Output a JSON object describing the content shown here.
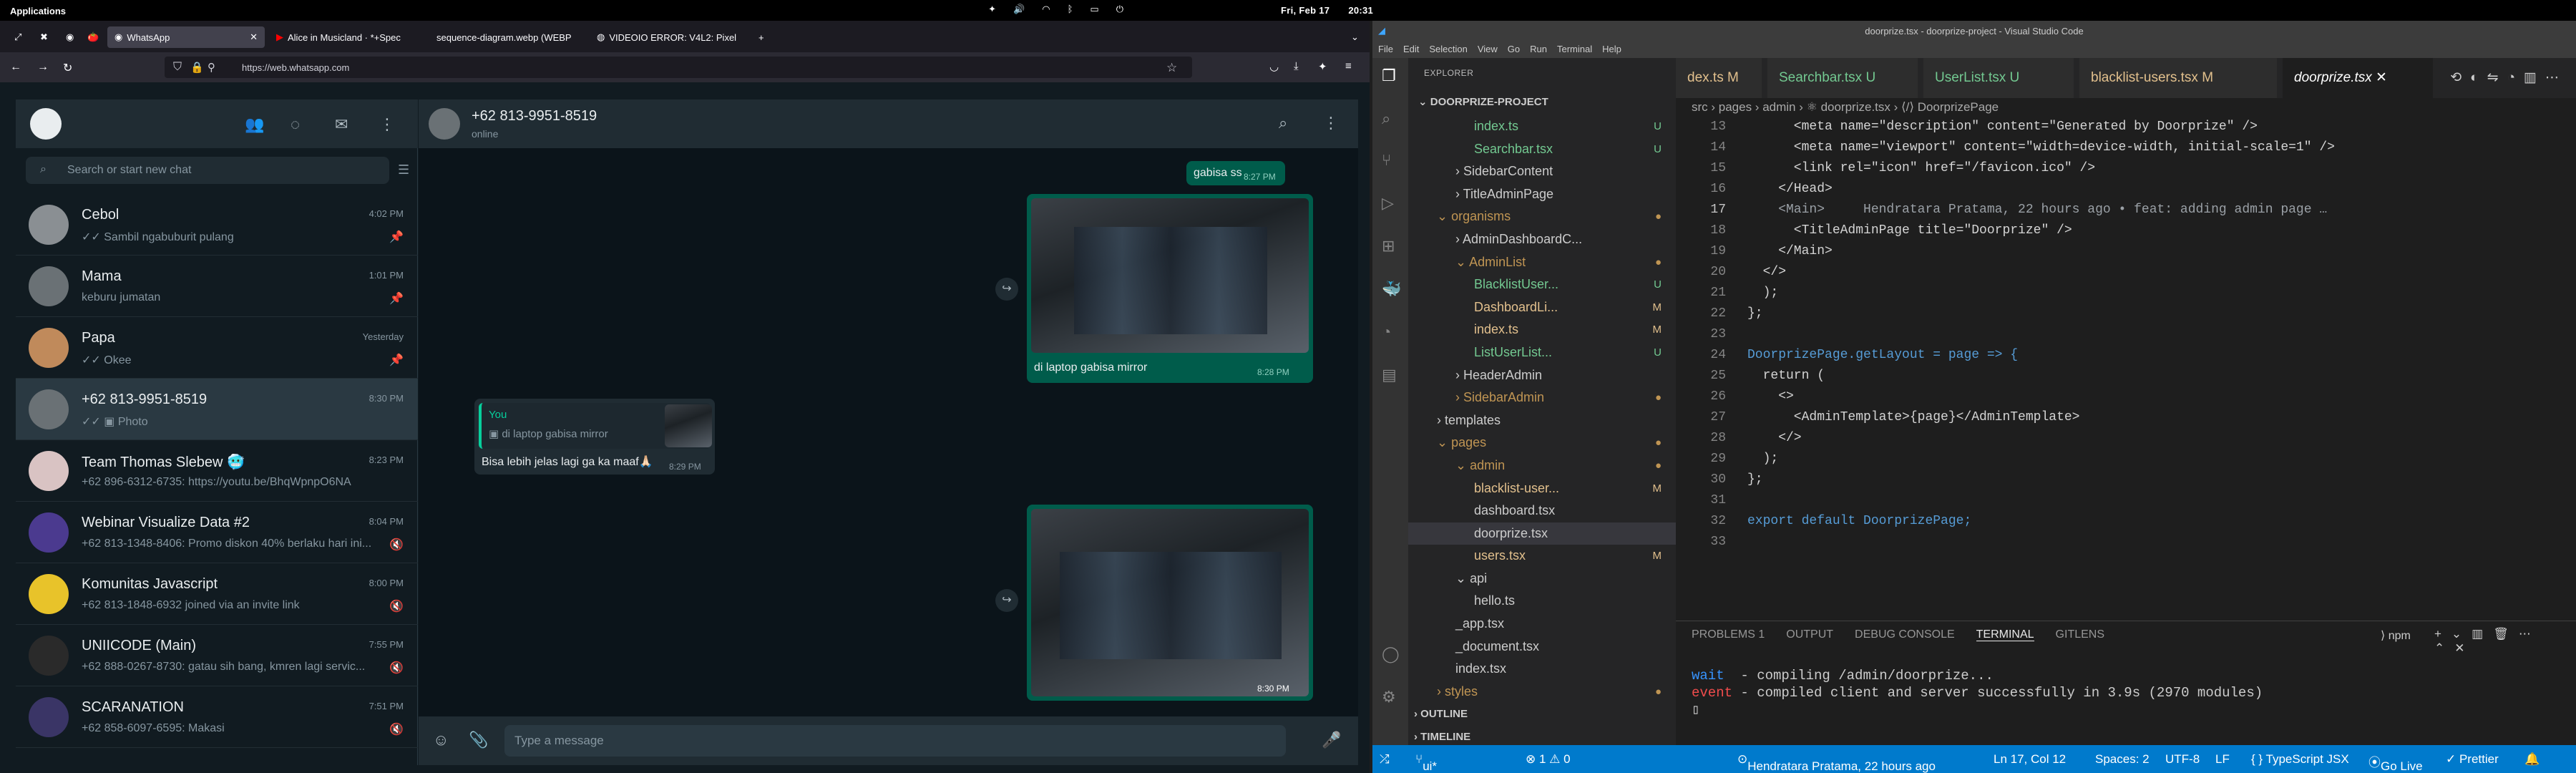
{
  "system": {
    "applications": "Applications",
    "date": "Fri, Feb 17",
    "time": "20:31"
  },
  "firefox": {
    "tabs": [
      "WhatsApp",
      "Alice in Musicland · *+Spec",
      "sequence-diagram.webp (WEBP",
      "VIDEOIO ERROR: V4L2: Pixel"
    ],
    "url": "https://web.whatsapp.com"
  },
  "whatsapp": {
    "search_placeholder": "Search or start new chat",
    "chats": [
      {
        "name": "Cebol",
        "time": "4:02 PM",
        "preview": "✓✓ Sambil ngabuburit pulang",
        "pinned": true
      },
      {
        "name": "Mama",
        "time": "1:01 PM",
        "preview": "keburu jumatan",
        "pinned": true
      },
      {
        "name": "Papa",
        "time": "Yesterday",
        "preview": "✓✓ Okee",
        "pinned": true
      },
      {
        "name": "+62 813-9951-8519",
        "time": "8:30 PM",
        "preview": "✓✓ ▣ Photo",
        "pinned": false
      },
      {
        "name": "Team Thomas Slebew 🥶",
        "time": "8:23 PM",
        "preview": "+62 896-6312-6735: https://youtu.be/BhqWpnpO6NA",
        "pinned": false
      },
      {
        "name": "Webinar Visualize Data #2",
        "time": "8:04 PM",
        "preview": "+62 813-1348-8406: Promo diskon 40% berlaku hari ini...",
        "pinned": false
      },
      {
        "name": "Komunitas Javascript",
        "time": "8:00 PM",
        "preview": "+62 813-1848-6932 joined via an invite link",
        "pinned": false
      },
      {
        "name": "UNIICODE (Main)",
        "time": "7:55 PM",
        "preview": "+62 888-0267-8730: gatau sih bang, kmren lagi servic...",
        "pinned": false
      },
      {
        "name": "SCARANATION",
        "time": "7:51 PM",
        "preview": "+62 858-6097-6595: Makasi",
        "pinned": false
      }
    ],
    "contact": {
      "name": "+62 813-9951-8519",
      "status": "online"
    },
    "messages": {
      "m1_text": "gabisa ss",
      "m1_time": "8:27 PM",
      "m2_caption": "di laptop gabisa mirror",
      "m2_time": "8:28 PM",
      "m3_reply_author": "You",
      "m3_reply_text": "▣ di laptop gabisa mirror",
      "m3_text": "Bisa lebih jelas lagi ga ka maaf🙏🏻",
      "m3_time": "8:29 PM",
      "m4_time": "8:30 PM"
    },
    "composer_placeholder": "Type a message"
  },
  "vscode": {
    "title": "doorprize.tsx - doorprize-project - Visual Studio Code",
    "menu": [
      "File",
      "Edit",
      "Selection",
      "View",
      "Go",
      "Run",
      "Terminal",
      "Help"
    ],
    "explorer": "EXPLORER",
    "project": "DOORPRIZE-PROJECT",
    "tree": [
      {
        "label": "index.ts",
        "badge": "U",
        "indent": 3
      },
      {
        "label": "Searchbar.tsx",
        "badge": "U",
        "indent": 3
      },
      {
        "label": "› SidebarContent",
        "badge": "",
        "indent": 2
      },
      {
        "label": "› TitleAdminPage",
        "badge": "",
        "indent": 2
      },
      {
        "label": "⌄ organisms",
        "badge": "●",
        "indent": 1
      },
      {
        "label": "› AdminDashboardC...",
        "badge": "",
        "indent": 2
      },
      {
        "label": "⌄ AdminList",
        "badge": "●",
        "indent": 2
      },
      {
        "label": "BlacklistUser...",
        "badge": "U",
        "indent": 3
      },
      {
        "label": "DashboardLi...",
        "badge": "M",
        "indent": 3
      },
      {
        "label": "index.ts",
        "badge": "M",
        "indent": 3
      },
      {
        "label": "ListUserList...",
        "badge": "U",
        "indent": 3
      },
      {
        "label": "› HeaderAdmin",
        "badge": "",
        "indent": 2
      },
      {
        "label": "› SidebarAdmin",
        "badge": "●",
        "indent": 2
      },
      {
        "label": "› templates",
        "badge": "",
        "indent": 1
      },
      {
        "label": "⌄ pages",
        "badge": "●",
        "indent": 1
      },
      {
        "label": "⌄ admin",
        "badge": "●",
        "indent": 2
      },
      {
        "label": "blacklist-user...",
        "badge": "M",
        "indent": 3
      },
      {
        "label": "dashboard.tsx",
        "badge": "",
        "indent": 3
      },
      {
        "label": "doorprize.tsx",
        "badge": "",
        "indent": 3
      },
      {
        "label": "users.tsx",
        "badge": "M",
        "indent": 3
      },
      {
        "label": "⌄ api",
        "badge": "",
        "indent": 2
      },
      {
        "label": "hello.ts",
        "badge": "",
        "indent": 3
      },
      {
        "label": "_app.tsx",
        "badge": "",
        "indent": 2
      },
      {
        "label": "_document.tsx",
        "badge": "",
        "indent": 2
      },
      {
        "label": "index.tsx",
        "badge": "",
        "indent": 2
      },
      {
        "label": "› styles",
        "badge": "●",
        "indent": 1
      },
      {
        "label": "› OUTLINE",
        "badge": "",
        "indent": 0
      },
      {
        "label": "› TIMELINE",
        "badge": "",
        "indent": 0
      }
    ],
    "tabs": [
      "dex.ts M",
      "Searchbar.tsx U",
      "UserList.tsx U",
      "blacklist-users.tsx M",
      "doorprize.tsx"
    ],
    "breadcrumb": "src › pages › admin › ⚛ doorprize.tsx › ⟨/⟩ DoorprizePage",
    "code": [
      {
        "n": "13",
        "t": "      <meta name=\"description\" content=\"Generated by Doorprize\" />"
      },
      {
        "n": "14",
        "t": "      <meta name=\"viewport\" content=\"width=device-width, initial-scale=1\" />"
      },
      {
        "n": "15",
        "t": "      <link rel=\"icon\" href=\"/favicon.ico\" />"
      },
      {
        "n": "16",
        "t": "    </Head>"
      },
      {
        "n": "17",
        "t": "    <Main>     Hendratara Pratama, 22 hours ago • feat: adding admin page …"
      },
      {
        "n": "18",
        "t": "      <TitleAdminPage title=\"Doorprize\" />"
      },
      {
        "n": "19",
        "t": "    </Main>"
      },
      {
        "n": "20",
        "t": "  </>"
      },
      {
        "n": "21",
        "t": "  );"
      },
      {
        "n": "22",
        "t": "};"
      },
      {
        "n": "23",
        "t": ""
      },
      {
        "n": "24",
        "t": "DoorprizePage.getLayout = page => {"
      },
      {
        "n": "25",
        "t": "  return ("
      },
      {
        "n": "26",
        "t": "    <>"
      },
      {
        "n": "27",
        "t": "      <AdminTemplate>{page}</AdminTemplate>"
      },
      {
        "n": "28",
        "t": "    </>"
      },
      {
        "n": "29",
        "t": "  );"
      },
      {
        "n": "30",
        "t": "};"
      },
      {
        "n": "31",
        "t": ""
      },
      {
        "n": "32",
        "t": "export default DoorprizePage;"
      },
      {
        "n": "33",
        "t": ""
      }
    ],
    "panel_tabs": [
      "PROBLEMS 1",
      "OUTPUT",
      "DEBUG CONSOLE",
      "TERMINAL",
      "GITLENS"
    ],
    "panel_active": "TERMINAL",
    "terminal": [
      "wait  - compiling /admin/doorprize...",
      "event - compiled client and server successfully in 3.9s (2970 modules)"
    ],
    "npm": "npm",
    "status": {
      "branch": "ui*",
      "errors": "⊗ 1 ⚠ 0",
      "blame": "Hendratara Pratama, 22 hours ago",
      "pos": "Ln 17, Col 12",
      "spaces": "Spaces: 2",
      "enc": "UTF-8",
      "eol": "LF",
      "lang": "{ } TypeScript JSX",
      "golive": "Go Live",
      "prettier": "✓ Prettier"
    }
  },
  "colors": {
    "wa_green": "#005c4b",
    "vs_blue": "#007acc"
  }
}
